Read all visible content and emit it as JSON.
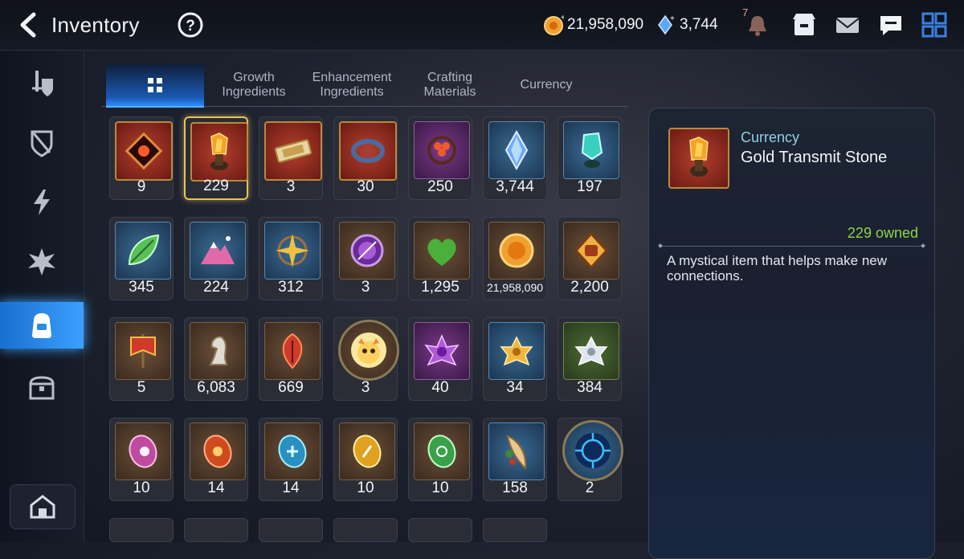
{
  "header": {
    "title": "Inventory",
    "gold": "21,958,090",
    "crystals": "3,744",
    "notification_badge": "7",
    "icons": [
      "back-arrow-icon",
      "help-icon",
      "gold-coin-icon",
      "crystal-icon",
      "bell-icon",
      "shop-icon",
      "mail-icon",
      "chat-icon",
      "grid-menu-icon"
    ]
  },
  "sidebar": {
    "items": [
      {
        "name": "equipment",
        "icon": "sword-shield-icon"
      },
      {
        "name": "artifacts",
        "icon": "broken-shield-icon"
      },
      {
        "name": "catalysts",
        "icon": "lightning-icon"
      },
      {
        "name": "specialty",
        "icon": "burst-icon"
      },
      {
        "name": "materials",
        "icon": "bag-icon",
        "active": true
      },
      {
        "name": "chests",
        "icon": "chest-icon"
      }
    ],
    "bottom_icon": "house-icon"
  },
  "tabs": [
    {
      "label": "",
      "icon": "grid-icon",
      "active": true
    },
    {
      "label": "Growth\nIngredients"
    },
    {
      "label": "Enhancement\nIngredients"
    },
    {
      "label": "Crafting\nMaterials"
    },
    {
      "label": "Currency"
    }
  ],
  "items": [
    {
      "count": "9",
      "bg": "r",
      "icon": "red-gem-frame-icon"
    },
    {
      "count": "229",
      "bg": "r",
      "icon": "gold-transmit-stone-icon",
      "selected": true
    },
    {
      "count": "3",
      "bg": "r",
      "icon": "ticket-icon"
    },
    {
      "count": "30",
      "bg": "r",
      "icon": "ring-charm-icon"
    },
    {
      "count": "250",
      "bg": "p",
      "icon": "flower-charm-icon"
    },
    {
      "count": "3,744",
      "bg": "b",
      "icon": "blue-crystal-icon"
    },
    {
      "count": "197",
      "bg": "b",
      "icon": "teal-crystal-icon"
    },
    {
      "count": "345",
      "bg": "b",
      "icon": "leaf-icon"
    },
    {
      "count": "224",
      "bg": "b",
      "icon": "pink-mountain-icon"
    },
    {
      "count": "312",
      "bg": "b",
      "icon": "star-compass-icon"
    },
    {
      "count": "3",
      "bg": "n",
      "icon": "purple-seal-icon"
    },
    {
      "count": "1,295",
      "bg": "n",
      "icon": "green-heart-icon"
    },
    {
      "count": "21,958,090",
      "bg": "n",
      "icon": "gold-coin-icon",
      "small": true
    },
    {
      "count": "2,200",
      "bg": "n",
      "icon": "fist-emblem-icon"
    },
    {
      "count": "5",
      "bg": "n",
      "icon": "banner-icon"
    },
    {
      "count": "6,083",
      "bg": "n",
      "icon": "knight-piece-icon"
    },
    {
      "count": "669",
      "bg": "n",
      "icon": "red-leaf-emblem-icon"
    },
    {
      "count": "3",
      "bg": "n",
      "icon": "mascot-portrait-icon",
      "round": true
    },
    {
      "count": "40",
      "bg": "p",
      "icon": "purple-lotus-icon"
    },
    {
      "count": "34",
      "bg": "b",
      "icon": "gold-lotus-icon"
    },
    {
      "count": "384",
      "bg": "g",
      "icon": "silver-lotus-icon"
    },
    {
      "count": "10",
      "bg": "n",
      "icon": "pink-rune-icon"
    },
    {
      "count": "14",
      "bg": "n",
      "icon": "red-rune-icon"
    },
    {
      "count": "14",
      "bg": "n",
      "icon": "cyan-rune-icon"
    },
    {
      "count": "10",
      "bg": "n",
      "icon": "yellow-rune-icon"
    },
    {
      "count": "10",
      "bg": "n",
      "icon": "green-rune-icon"
    },
    {
      "count": "158",
      "bg": "b",
      "icon": "feather-charm-icon"
    },
    {
      "count": "2",
      "bg": "b",
      "icon": "blue-circuit-emblem-icon",
      "round": true
    }
  ],
  "partial_row_count": 6,
  "detail": {
    "category": "Currency",
    "name": "Gold Transmit Stone",
    "owned": "229 owned",
    "description": "A mystical item that helps make new connections."
  },
  "colors": {
    "accent_blue": "#2f8cff",
    "selected_border": "#e6c35a",
    "owned_green": "#8fd24a",
    "category_cyan": "#8fd0e6"
  }
}
